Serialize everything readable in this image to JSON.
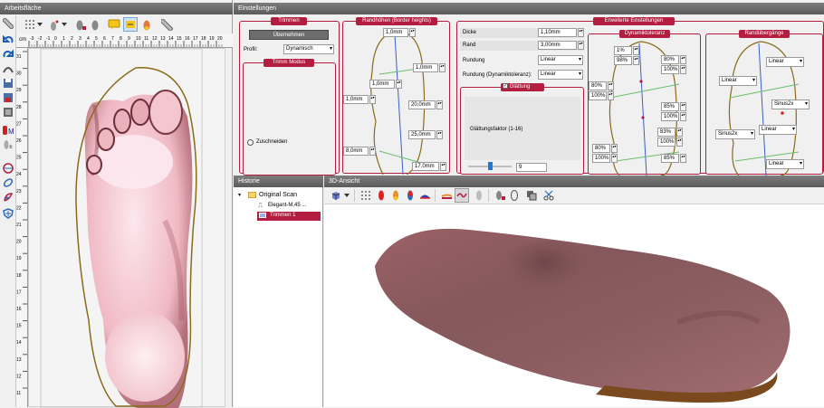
{
  "panels": {
    "workspace_title": "Arbeitsfläche",
    "settings_title": "Einstellungen",
    "history_title": "Historie",
    "view3d_title": "3D-Ansicht"
  },
  "ruler": {
    "unit": "cm",
    "h_ticks": [
      "-3",
      "-2",
      "-1",
      "0",
      "1",
      "2",
      "3",
      "4",
      "5",
      "6",
      "7",
      "8",
      "9",
      "10",
      "11",
      "12",
      "13",
      "14",
      "15",
      "16",
      "17",
      "18",
      "19",
      "20"
    ],
    "v_ticks": [
      "31",
      "30",
      "29",
      "28",
      "27",
      "26",
      "25",
      "24",
      "23",
      "22",
      "21",
      "20",
      "19",
      "18",
      "17",
      "16",
      "15",
      "14",
      "13",
      "12",
      "11"
    ]
  },
  "trimmen": {
    "title": "Trimmen",
    "apply_label": "Übernehmen",
    "profile_label": "Profil:",
    "profile_value": "Dynamisch",
    "mode_title": "Trimm Modus",
    "cut_label": "Zuschneiden"
  },
  "rand": {
    "title": "Randhöhen (Border heights)",
    "values": [
      "1,0mm",
      "1,0mm",
      "1,0mm",
      "1,0mm",
      "20,0mm",
      "25,0mm",
      "8,0mm",
      "17,0mm"
    ]
  },
  "advanced": {
    "title": "Erweiterte Einstellungen",
    "dicke_label": "Dicke",
    "dicke_value": "1,10mm",
    "rand_label": "Rand",
    "rand_value": "3,00mm",
    "rundung_label": "Rundung",
    "rundung_value": "Linear",
    "rundung_dyn_label": "Rundung (Dynamiktoleranz):",
    "rundung_dyn_value": "Linear",
    "glaettung_title": "Glättung",
    "glaettung_factor_label": "Glättungsfaktor (1-16)",
    "glaettung_value": "9"
  },
  "dynamik": {
    "title": "Dynamiktoleranz",
    "values": [
      "1%",
      "98%",
      "80%",
      "100%",
      "80%",
      "100%",
      "85%",
      "100%",
      "83%",
      "100%",
      "80%",
      "100%",
      "85%"
    ]
  },
  "randuebergaenge": {
    "title": "Randübergänge",
    "values": [
      "Linear",
      "Linear",
      "Sinus2x",
      "Sinus2x",
      "Linear",
      "Linear"
    ]
  },
  "history": {
    "items": [
      "Original Scan",
      "Elegant-M,45 ...",
      "Trimmen 1"
    ]
  },
  "colors": {
    "accent": "#b31d3f",
    "insole": "#8b5a5e",
    "outline": "#8a6b1a"
  }
}
